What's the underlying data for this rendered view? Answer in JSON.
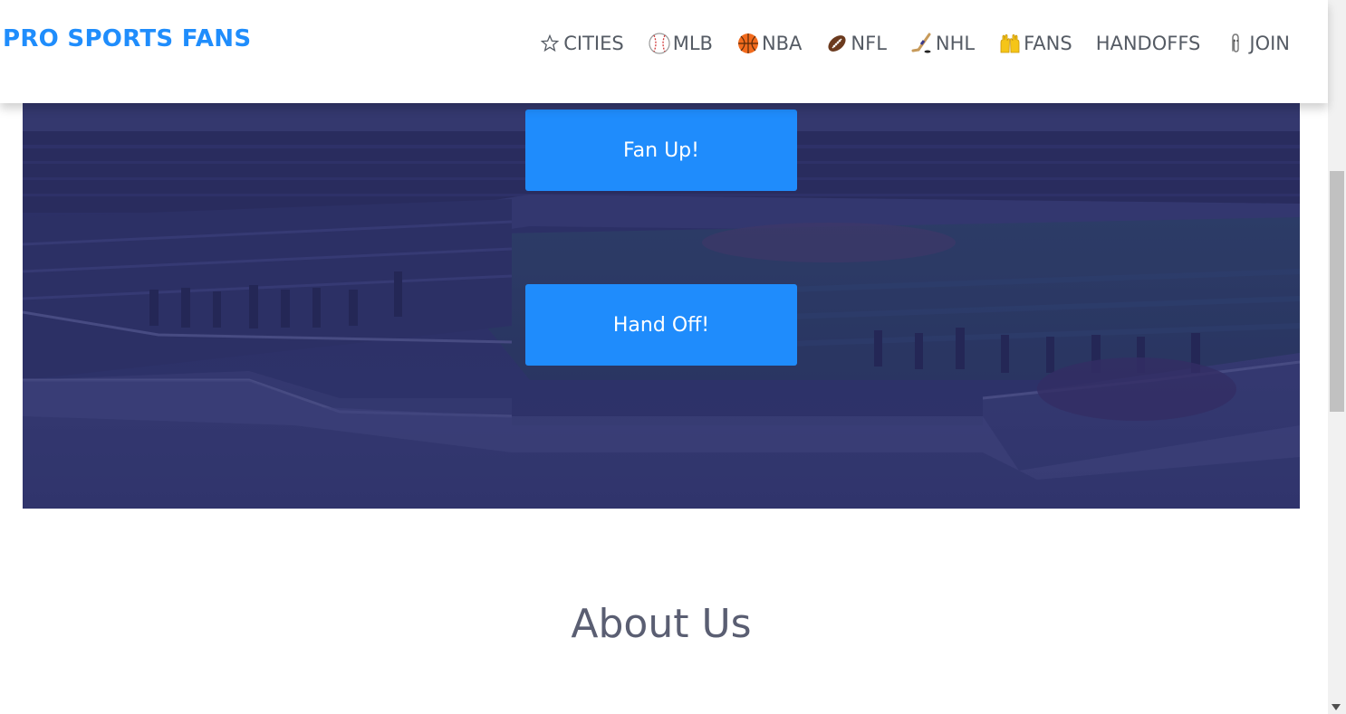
{
  "header": {
    "brand": "PRO SPORTS FANS",
    "nav": [
      {
        "icon": "star-icon",
        "label": "CITIES"
      },
      {
        "icon": "baseball-icon",
        "label": "MLB"
      },
      {
        "icon": "basketball-icon",
        "label": "NBA"
      },
      {
        "icon": "football-icon",
        "label": "NFL"
      },
      {
        "icon": "hockey-stick-icon",
        "label": "NHL"
      },
      {
        "icon": "raised-hands-icon",
        "label": "FANS"
      },
      {
        "icon": "",
        "label": "HANDOFFS"
      },
      {
        "icon": "paperclip-icon",
        "label": "JOIN"
      }
    ]
  },
  "hero": {
    "fan_up_label": "Fan Up!",
    "hand_off_label": "Hand Off!"
  },
  "about": {
    "title": "About Us"
  },
  "colors": {
    "brand": "#1f8dfc",
    "button": "#1f8cfc",
    "nav_text": "#555b64",
    "heading": "#5a5e72"
  }
}
